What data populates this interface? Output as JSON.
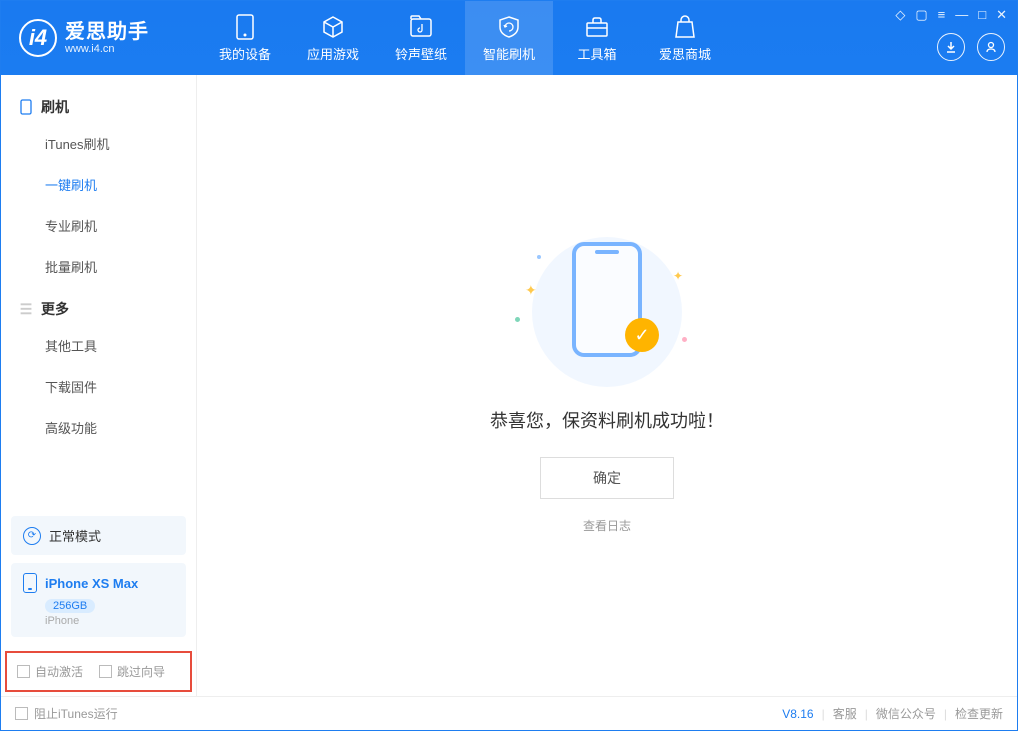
{
  "logo": {
    "main": "爱思助手",
    "sub": "www.i4.cn"
  },
  "nav": {
    "device": "我的设备",
    "apps": "应用游戏",
    "ringtones": "铃声壁纸",
    "flash": "智能刷机",
    "tools": "工具箱",
    "store": "爱思商城"
  },
  "sidebar": {
    "group_flash": "刷机",
    "items_flash": {
      "itunes": "iTunes刷机",
      "onekey": "一键刷机",
      "pro": "专业刷机",
      "batch": "批量刷机"
    },
    "group_more": "更多",
    "items_more": {
      "other": "其他工具",
      "firmware": "下载固件",
      "advanced": "高级功能"
    },
    "mode_card": "正常模式",
    "device_card": {
      "name": "iPhone XS Max",
      "storage": "256GB",
      "type": "iPhone"
    },
    "check_auto_activate": "自动激活",
    "check_skip_guide": "跳过向导"
  },
  "main": {
    "success_text": "恭喜您，保资料刷机成功啦！",
    "ok_button": "确定",
    "log_link": "查看日志"
  },
  "status": {
    "block_itunes": "阻止iTunes运行",
    "version": "V8.16",
    "support": "客服",
    "wechat": "微信公众号",
    "update": "检查更新"
  }
}
